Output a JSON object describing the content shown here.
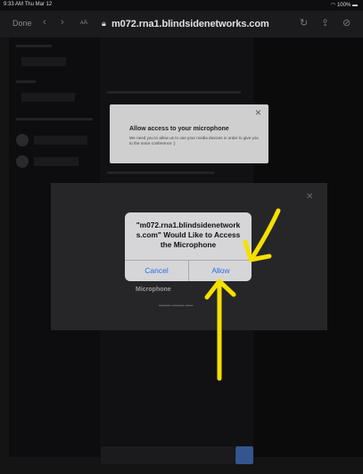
{
  "status_bar": {
    "time": "9:33 AM  Thu Mar 12",
    "battery": "100%"
  },
  "browser": {
    "done_label": "Done",
    "url": "m072.rna1.blindsidenetworks.com",
    "icons": [
      "back-icon",
      "forward-icon",
      "text-size-icon",
      "lock-icon",
      "reload-icon",
      "share-icon",
      "compass-icon"
    ]
  },
  "web_dialog": {
    "title": "Allow access to your microphone",
    "body": "We need you to allow us to use your media devices in order to give you to the voice conference :)"
  },
  "system_alert": {
    "message": "\"m072.rna1.blindsidenetwork s.com\" Would Like to Access the Microphone",
    "cancel_label": "Cancel",
    "allow_label": "Allow"
  },
  "audio_modal": {
    "choice_label": "Microphone"
  },
  "colors": {
    "alert_button": "#2e6ce6",
    "arrow": "#f5e000",
    "background": "#141414"
  }
}
